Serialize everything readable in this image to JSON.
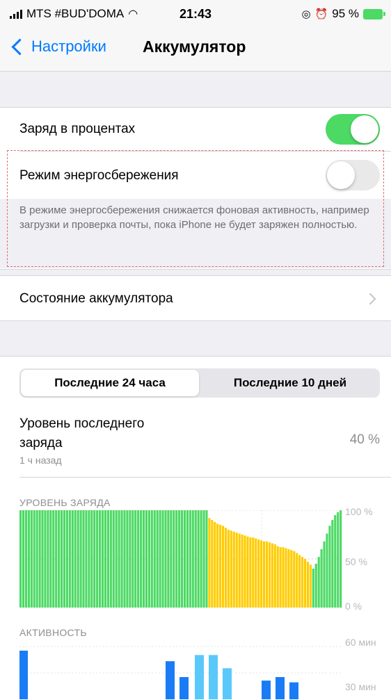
{
  "status_bar": {
    "carrier": "MTS #BUD'DOMA",
    "time": "21:43",
    "battery_percent": "95 %"
  },
  "nav": {
    "back_label": "Настройки",
    "title": "Аккумулятор"
  },
  "settings": {
    "battery_percentage_label": "Заряд в процентах",
    "battery_percentage_on": true,
    "low_power_label": "Режим энергосбережения",
    "low_power_on": false,
    "low_power_note": "В режиме энергосбережения снижается фоновая активность, например загрузки и проверка почты, пока iPhone не будет заряжен полностью.",
    "battery_health_label": "Состояние аккумулятора"
  },
  "usage": {
    "tabs": [
      "Последние 24 часа",
      "Последние 10 дней"
    ],
    "selected_tab": 0,
    "last_charge_label_line1": "Уровень последнего",
    "last_charge_label_line2": "заряда",
    "last_charge_time": "1 ч назад",
    "last_charge_value": "40 %"
  },
  "charts": {
    "level_title": "УРОВЕНЬ ЗАРЯДА",
    "level_ticks": [
      "100 %",
      "50 %",
      "0 %"
    ],
    "activity_title": "АКТИВНОСТЬ",
    "activity_ticks": [
      "60 мин",
      "30 мин"
    ]
  },
  "colors": {
    "accent": "#007aff",
    "toggle_on": "#4cd964",
    "charging": "#4cd964",
    "low_power": "#ffcc00",
    "screen_on": "#1a7cf5",
    "screen_off": "#5ac8fa"
  },
  "chart_data": [
    {
      "type": "bar",
      "title": "УРОВЕНЬ ЗАРЯДА",
      "ylim": [
        0,
        100
      ],
      "y_ticks": [
        "100 %",
        "50 %",
        "0 %"
      ],
      "series": [
        {
          "name": "",
          "color": "#4cd964",
          "values": [
            100,
            100,
            100,
            100,
            100,
            100,
            100,
            100,
            100,
            100,
            100,
            100,
            100,
            100,
            100,
            100,
            100,
            100,
            100,
            100,
            100,
            100,
            100,
            100,
            100,
            100,
            100,
            100,
            100,
            100,
            100,
            100,
            100,
            100,
            100,
            100,
            100,
            100,
            100,
            100,
            100,
            100,
            100,
            100,
            100,
            100,
            100,
            100,
            100,
            100,
            100,
            100,
            100,
            100,
            100,
            100,
            100,
            100,
            100,
            100,
            100,
            100,
            100,
            100,
            100,
            100,
            100,
            100,
            100
          ]
        },
        {
          "name": "",
          "color": "#ffcc00",
          "values": [
            92,
            90,
            88,
            86,
            85,
            84,
            82,
            80,
            79,
            78,
            77,
            76,
            75,
            74,
            73,
            72,
            72,
            71,
            70,
            69,
            68,
            68,
            67,
            66,
            65,
            63,
            62,
            62,
            61,
            60,
            59,
            58,
            56,
            54,
            52,
            50,
            47,
            44
          ]
        },
        {
          "name": "",
          "color": "#4cd964",
          "values": [
            40,
            45,
            52,
            60,
            68,
            76,
            84,
            90,
            95,
            98,
            100
          ]
        }
      ]
    },
    {
      "type": "bar",
      "title": "АКТИВНОСТЬ",
      "ylim": [
        0,
        60
      ],
      "y_ticks": [
        "60 мин",
        "30 мин"
      ],
      "series": [
        {
          "name": "",
          "color": "#1a7cf5",
          "values": [
            60,
            0,
            0,
            0,
            0,
            0,
            0,
            0,
            0,
            0,
            0,
            0,
            0,
            0,
            0,
            0,
            0,
            0,
            0,
            0,
            0,
            0,
            0,
            0,
            0,
            0,
            0,
            0,
            0,
            0,
            0,
            0,
            0,
            0,
            0,
            0,
            0,
            0,
            0,
            0,
            0,
            0,
            0,
            0,
            0,
            0,
            0,
            0,
            0,
            0,
            0,
            0,
            0,
            0,
            0,
            0,
            0,
            0,
            0,
            0,
            0,
            0,
            0,
            0,
            0,
            0,
            0,
            0,
            0
          ]
        },
        {
          "name": "",
          "color": "#1a7cf5",
          "values": [
            48,
            30
          ]
        },
        {
          "name": "",
          "color": "#5ac8fa",
          "values": [
            55,
            55,
            40
          ]
        },
        {
          "name": "",
          "color": "#1a7cf5",
          "values": [
            26,
            30,
            24
          ]
        }
      ]
    }
  ]
}
